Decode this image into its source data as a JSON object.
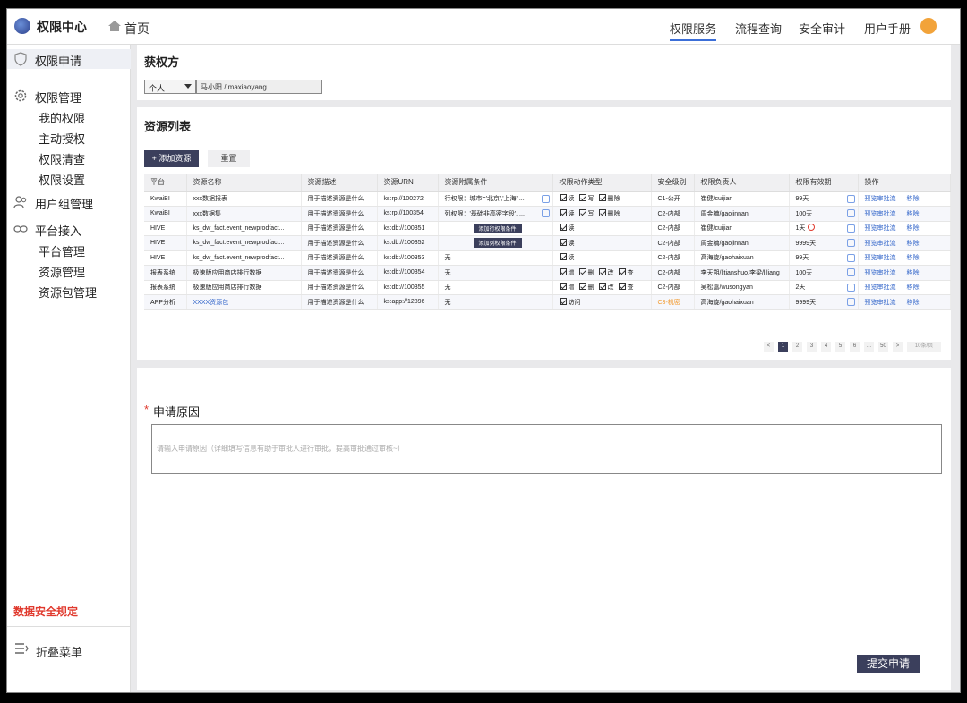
{
  "app": {
    "title": "权限中心",
    "home": "首页"
  },
  "nav": {
    "items": [
      "权限服务",
      "流程查询",
      "安全审计",
      "用户手册"
    ],
    "active": "权限服务"
  },
  "sidebar": {
    "apply": "权限申请",
    "manage": "权限管理",
    "manage_items": [
      "我的权限",
      "主动授权",
      "权限清查",
      "权限设置"
    ],
    "usergroup": "用户组管理",
    "platform": "平台接入",
    "platform_items": [
      "平台管理",
      "资源管理",
      "资源包管理"
    ],
    "data_rule": "数据安全规定",
    "collapse": "折叠菜单"
  },
  "grantee": {
    "title": "获权方",
    "type": "个人",
    "user": "马小阳 / maxiaoyang"
  },
  "resource_list": {
    "title": "资源列表",
    "add_button": "+ 添加资源",
    "reset_button": "重置",
    "columns": [
      "平台",
      "资源名称",
      "资源描述",
      "资源URN",
      "资源附属条件",
      "权限动作类型",
      "安全级别",
      "权限负责人",
      "权限有效期",
      "操作"
    ],
    "rows": [
      {
        "platform": "KwaiBI",
        "name": "xxx数据报表",
        "desc": "用于描述资源是什么",
        "urn": "ks:rp://100272",
        "cond": "行权限：城市='北京','上海' ...",
        "perms": [
          "读",
          "写",
          "删除"
        ],
        "level": "C1-公开",
        "owner": "崔健/cuijian",
        "validity": "99天",
        "op1": "预览审批流",
        "op2": "移除"
      },
      {
        "platform": "KwaiBI",
        "name": "xxx数据集",
        "desc": "用于描述资源是什么",
        "urn": "ks:rp://100354",
        "cond": "列权限：'基础非高密字段', ...",
        "perms": [
          "读",
          "写",
          "删除"
        ],
        "level": "C2-内部",
        "owner": "周金楠/gaojinnan",
        "validity": "100天",
        "op1": "预览审批流",
        "op2": "移除"
      },
      {
        "platform": "HIVE",
        "name": "ks_dw_fact.event_newprodfact...",
        "desc": "用于描述资源是什么",
        "urn": "ks:db://100351",
        "cond_button": "添加行权限条件",
        "perms": [
          "读"
        ],
        "level": "C2-内部",
        "owner": "崔健/cuijian",
        "validity": "1天",
        "op1": "预览审批流",
        "op2": "移除"
      },
      {
        "platform": "HIVE",
        "name": "ks_dw_fact.event_newprodfact...",
        "desc": "用于描述资源是什么",
        "urn": "ks:db://100352",
        "cond_button": "添加列权限条件",
        "perms": [
          "读"
        ],
        "level": "C2-内部",
        "owner": "周金楠/gaojinnan",
        "validity": "9999天",
        "op1": "预览审批流",
        "op2": "移除"
      },
      {
        "platform": "HIVE",
        "name": "ks_dw_fact.event_newprodfact...",
        "desc": "用于描述资源是什么",
        "urn": "ks:db://100353",
        "cond": "无",
        "perms": [
          "读"
        ],
        "level": "C2-内部",
        "owner": "高海旋/gaohaixuan",
        "validity": "99天",
        "op1": "预览审批流",
        "op2": "移除"
      },
      {
        "platform": "报表系统",
        "name": "极速版应用商店排行数据",
        "desc": "用于描述资源是什么",
        "urn": "ks:db://100354",
        "cond": "无",
        "perms": [
          "增",
          "删",
          "改",
          "查"
        ],
        "level": "C2-内部",
        "owner": "李天朔/litianshuo,李梁/liliang",
        "validity": "100天",
        "op1": "预览审批流",
        "op2": "移除"
      },
      {
        "platform": "报表系统",
        "name": "极速版应用商店排行数据",
        "desc": "用于描述资源是什么",
        "urn": "ks:db://100355",
        "cond": "无",
        "perms": [
          "增",
          "删",
          "改",
          "查"
        ],
        "level": "C2-内部",
        "owner": "吴松嘉/wusongyan",
        "validity": "2天",
        "op1": "预览审批流",
        "op2": "移除"
      },
      {
        "platform": "APP分析",
        "name": "XXXX资源包",
        "desc": "用于描述资源是什么",
        "urn": "ks:app://12896",
        "cond": "无",
        "perms": [
          "访问"
        ],
        "level": "C3-机密",
        "owner": "高海旋/gaohaixuan",
        "validity": "9999天",
        "op1": "预览审批流",
        "op2": "移除"
      }
    ],
    "pagination": {
      "pages": [
        "<",
        "1",
        "2",
        "3",
        "4",
        "5",
        "6",
        "...",
        "50",
        ">"
      ],
      "current": "1",
      "page_size": "10条/页"
    }
  },
  "reason": {
    "star": "*",
    "title": "申请原因",
    "placeholder": "请输入申请原因（详细填写信息有助于审批人进行审批，提高审批通过审核~）",
    "submit": "提交申请"
  }
}
